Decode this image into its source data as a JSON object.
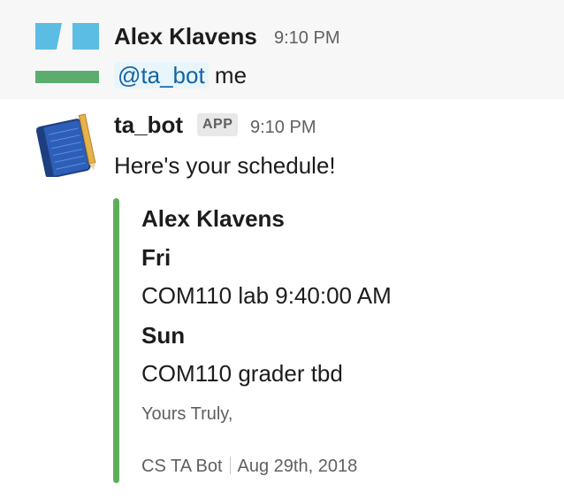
{
  "messages": [
    {
      "sender": "Alex Klavens",
      "time": "9:10 PM",
      "mention": "@ta_bot",
      "text": "me",
      "avatar": "identicon-avatar"
    },
    {
      "sender": "ta_bot",
      "badge": "APP",
      "time": "9:10 PM",
      "text": "Here's your schedule!",
      "avatar": "notebook-avatar",
      "attachment": {
        "accent_color": "#5fad5c",
        "title": "Alex Klavens",
        "fields": [
          {
            "title": "Fri",
            "value": "COM110 lab 9:40:00 AM"
          },
          {
            "title": "Sun",
            "value": "COM110 grader tbd"
          }
        ],
        "pretext": "Yours Truly,",
        "footer": "CS TA Bot",
        "footer_date": "Aug 29th, 2018"
      }
    }
  ],
  "colors": {
    "highlight_bg": "#f7f7f7",
    "mention_bg": "#e8f5fa",
    "mention_text": "#1264a3",
    "avatar_blue": "#5bbde4",
    "avatar_green": "#5aad6f"
  }
}
